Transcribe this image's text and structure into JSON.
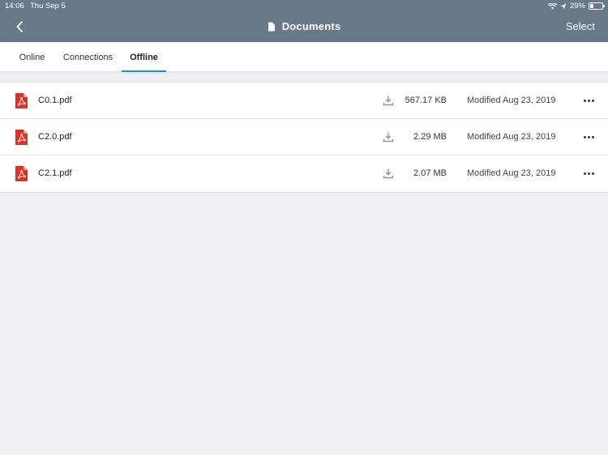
{
  "status_bar": {
    "time": "14:06",
    "date": "Thu Sep 5",
    "battery_percent": "29%",
    "battery_level": 0.29
  },
  "nav": {
    "title": "Documents",
    "select_label": "Select",
    "title_icon": "document-icon",
    "back_icon": "chevron-left-icon"
  },
  "tabs": [
    {
      "label": "Online",
      "active": false
    },
    {
      "label": "Connections",
      "active": false
    },
    {
      "label": "Offline",
      "active": true
    }
  ],
  "files": [
    {
      "name": "C0.1.pdf",
      "size": "567.17 KB",
      "modified": "Modified Aug 23, 2019"
    },
    {
      "name": "C2.0.pdf",
      "size": "2.29 MB",
      "modified": "Modified Aug 23, 2019"
    },
    {
      "name": "C2.1.pdf",
      "size": "2.07 MB",
      "modified": "Modified Aug 23, 2019"
    }
  ],
  "colors": {
    "header_bg": "#68798a",
    "accent": "#1a8fdc",
    "pdf_red": "#d9342b",
    "page_bg": "#efeff4"
  }
}
